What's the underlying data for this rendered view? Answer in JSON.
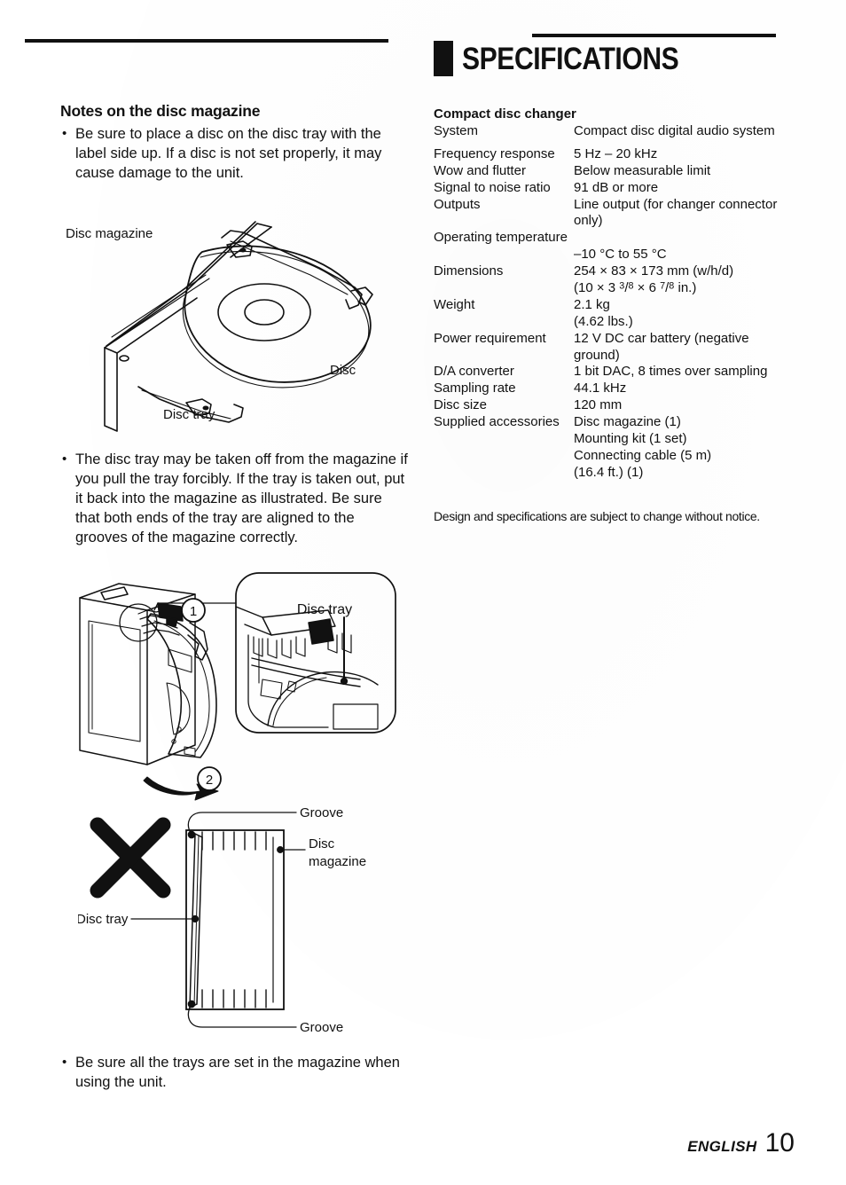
{
  "document": {
    "header_title": "SPECIFICATIONS",
    "footer_language": "ENGLISH",
    "footer_page": "10"
  },
  "left_column": {
    "section_heading": "Notes on the disc magazine",
    "bullets": [
      "Be sure to place a disc on the disc tray with the label side up.  If a disc is not set properly, it may cause damage to the unit.",
      "The disc tray may be taken off from the magazine if you pull the tray forcibly.  If the tray is taken out, put it back into the magazine as illustrated. Be sure that both ends of the tray are aligned to the grooves of the magazine correctly.",
      "Be sure all the trays are set in the magazine when using the unit."
    ]
  },
  "figures": {
    "figure1": {
      "labels": {
        "disc_magazine": "Disc magazine",
        "disc": "Disc",
        "disc_tray": "Disc tray"
      }
    },
    "figure2": {
      "labels": {
        "step_one": "1",
        "step_two": "2",
        "disc_tray": "Disc tray"
      }
    },
    "figure3": {
      "labels": {
        "groove_top": "Groove",
        "groove_bottom": "Groove",
        "disc_magazine_line1": "Disc",
        "disc_magazine_line2": "magazine",
        "disc_tray": "Disc tray"
      }
    }
  },
  "specifications": {
    "subheading": "Compact disc changer",
    "rows": [
      {
        "label": "System",
        "value": "Compact disc digital audio system"
      },
      {
        "label": "",
        "value": "",
        "spacer": true
      },
      {
        "label": "Frequency response",
        "value": "5 Hz – 20 kHz"
      },
      {
        "label": "Wow and flutter",
        "value": "Below measurable limit"
      },
      {
        "label": "Signal to noise ratio",
        "value": "91 dB or more"
      },
      {
        "label": "Outputs",
        "value": "Line output (for changer connector only)"
      },
      {
        "label": "Operating temperature",
        "value": "–10 °C to 55 °C",
        "full_width_label": true
      },
      {
        "label": "Dimensions",
        "value": "254 × 83 × 173 mm (w/h/d)",
        "value2": "(10 × 3 3/8 × 6 7/8 in.)"
      },
      {
        "label": "Weight",
        "value": "2.1 kg",
        "value2": "(4.62 lbs.)"
      },
      {
        "label": "Power requirement",
        "value": "12 V DC car battery (negative ground)"
      },
      {
        "label": "D/A converter",
        "value": "1 bit DAC, 8 times over sampling"
      },
      {
        "label": "Sampling rate",
        "value": "44.1 kHz"
      },
      {
        "label": "Disc size",
        "value": "120 mm"
      },
      {
        "label": "Supplied accessories",
        "value": "Disc magazine (1)",
        "value2": "Mounting kit (1 set)",
        "value3": "Connecting cable (5 m)",
        "value4": "(16.4 ft.) (1)"
      }
    ],
    "dimensions_parts": {
      "inch_prefix": "(10 × 3 ",
      "frac1_num": "3",
      "frac1_den": "8",
      "inch_mid": " × 6 ",
      "frac2_num": "7",
      "frac2_den": "8",
      "inch_suffix": " in.)"
    },
    "disclaimer": "Design and specifications are subject to change without notice."
  }
}
